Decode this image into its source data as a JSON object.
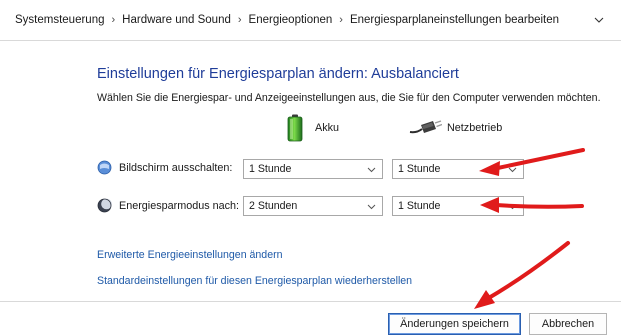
{
  "breadcrumb": {
    "items": [
      "Systemsteuerung",
      "Hardware und Sound",
      "Energieoptionen",
      "Energiesparplaneinstellungen bearbeiten"
    ],
    "separator": "›"
  },
  "main": {
    "title": "Einstellungen für Energiesparplan ändern: Ausbalanciert",
    "subtitle": "Wählen Sie die Energiespar- und Anzeigeeinstellungen aus, die Sie für den Computer verwenden möchten.",
    "columns": {
      "battery": "Akku",
      "plugged": "Netzbetrieb"
    },
    "rows": [
      {
        "label": "Bildschirm ausschalten:",
        "battery_value": "1 Stunde",
        "plugged_value": "1 Stunde"
      },
      {
        "label": "Energiesparmodus nach:",
        "battery_value": "2 Stunden",
        "plugged_value": "1 Stunde"
      }
    ],
    "links": {
      "advanced": "Erweiterte Energieeinstellungen ändern",
      "restore": "Standardeinstellungen für diesen Energiesparplan wiederherstellen"
    }
  },
  "footer": {
    "save": "Änderungen speichern",
    "cancel": "Abbrechen"
  },
  "colors": {
    "title": "#1f3d99",
    "link": "#1f5aa8",
    "annotation_arrow": "#e01b1b"
  },
  "icons": [
    "chevron-down-icon",
    "battery-icon",
    "power-plug-icon",
    "monitor-icon",
    "sleep-moon-icon"
  ]
}
